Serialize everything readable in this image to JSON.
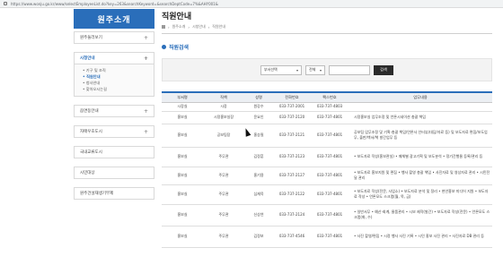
{
  "browser": {
    "url": "https://www.wonju.go.kr/www/selectEmployeeList.do?key=263&searchKeyword=&searchDeptCode=7%&AHY001&"
  },
  "sidebar": {
    "title": "원주소개",
    "items": [
      {
        "label": "원주둘러보기",
        "expand": "+"
      },
      {
        "label": "시청안내",
        "expand": "+",
        "active": true,
        "sub": [
          {
            "label": "• 기구 및 조직"
          },
          {
            "label": "• 직원안내",
            "active": true
          },
          {
            "label": "• 청사안내"
          },
          {
            "label": "• 찾아오시는길"
          }
        ]
      },
      {
        "label": "읍면동안내",
        "expand": "+"
      },
      {
        "label": "자매우호도시",
        "expand": "+"
      },
      {
        "label": "국내교류도시",
        "expand": ""
      },
      {
        "label": "시민대상",
        "expand": ""
      },
      {
        "label": "원주건설재생기부제",
        "expand": ""
      }
    ]
  },
  "header": {
    "page_title": "직원안내",
    "breadcrumb": [
      "원주소개",
      "시청안내",
      "직원안내"
    ]
  },
  "search": {
    "section_title": "직원검색",
    "dept_select": "부서선택",
    "field_select": "전체",
    "input_value": "",
    "button_label": "검색"
  },
  "table": {
    "columns": [
      "부서명",
      "직책",
      "성명",
      "전화번호",
      "팩스번호",
      "업무내용"
    ],
    "rows": [
      {
        "dept": "시장실",
        "title": "시장",
        "name": "원강수",
        "phone": "033-737-2001",
        "fax": "033-737-4803",
        "duty": ""
      },
      {
        "dept": "홍보실",
        "title": "시정홍보실장",
        "name": "윤요인",
        "phone": "033-737-2120",
        "fax": "033-737-4801",
        "duty": "시정홍보실 업무조정 및 언론시네이션 총괄 책임"
      },
      {
        "dept": "홍보실",
        "title": "공보팀장",
        "name": "홍승필",
        "phone": "033-737-2121",
        "fax": "033-737-4801",
        "duty": "공보팀 업무조정 및 기획·총괄 책임/언론사 인터뷰(대담/자료 등) 및 보도자료 편집/보도업무, 출판/백서/책 발간업무 등"
      },
      {
        "dept": "홍보실",
        "title": "주무관",
        "name": "김정훈",
        "phone": "033-737-2123",
        "fax": "033-737-4801",
        "duty": "• 보도자료 작성(홍보관실) • 매체별 광고기획 및 보도분석 • 정기간행물 등록/관리 등"
      },
      {
        "dept": "홍보실",
        "title": "주무관",
        "name": "홍기용",
        "phone": "033-737-2127",
        "fax": "033-737-4801",
        "duty": "• 보도자료 홍보지원 및 편집 • 행사 촬영 총괄 책임 • 사진자료 및 영상자료 관리 • 시민전달 관리"
      },
      {
        "dept": "홍보실",
        "title": "주무관",
        "name": "심재욱",
        "phone": "033-737-2122",
        "fax": "033-737-4801",
        "duty": "• 보도자료 작성(전문, 사업소) • 보도자료 분석 및 정리 • 현안홍보 미디어 지원 • 보도자료 작성 • 언론모도 스크랩(월, 목, 금)"
      },
      {
        "dept": "홍보실",
        "title": "주무관",
        "name": "신상연",
        "phone": "033-737-2124",
        "fax": "033-737-4801",
        "duty": "• 일반서무 • 예산·회계, 물품관리 • 시보 제작(발간) • 보도자료 작성(전문) • 언론모도 스크랩(화, 수)"
      },
      {
        "dept": "홍보실",
        "title": "주무관",
        "name": "김정보",
        "phone": "033-737-4546",
        "fax": "033-737-4801",
        "duty": "• 사진 촬영/편집 • 시정 행사 사진 기록 • 시민 홍보 사진 관리 • 사진자료 DB 관리 등"
      }
    ]
  }
}
